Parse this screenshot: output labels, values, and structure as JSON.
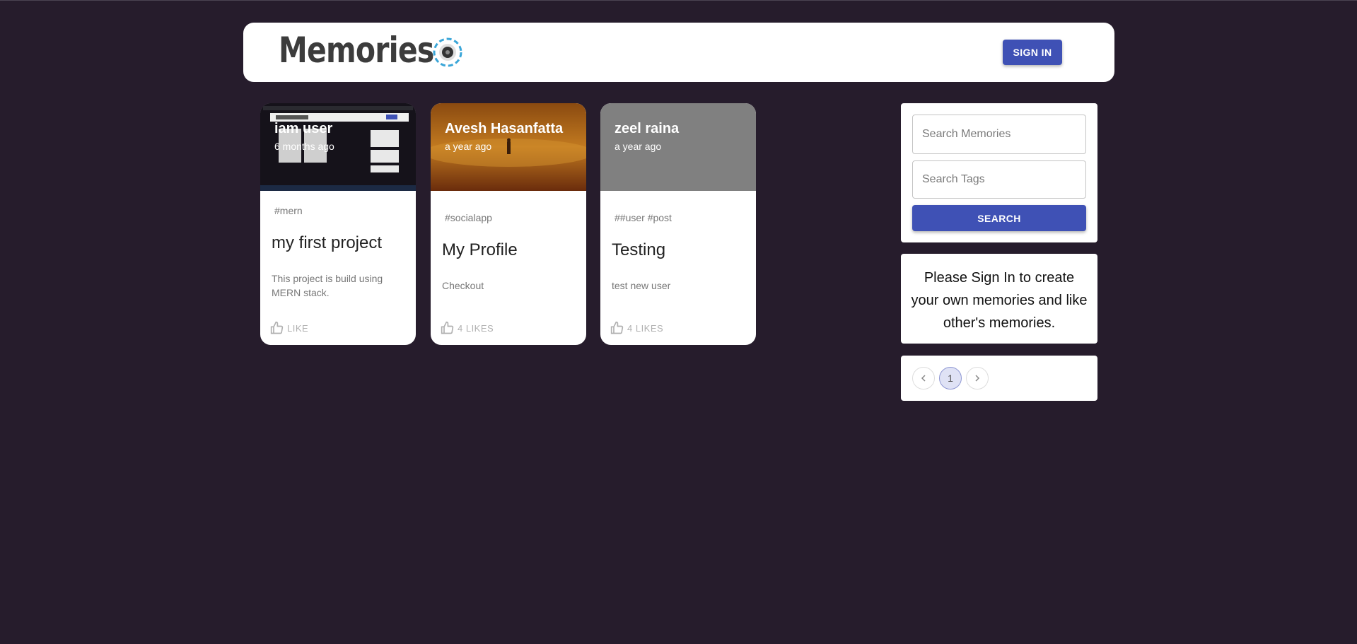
{
  "header": {
    "brand": "Memories",
    "signin_label": "SIGN IN"
  },
  "posts": [
    {
      "author": "iam user",
      "time": "6 months ago",
      "tags": "#mern",
      "title": "my first project",
      "message": "This project is build using MERN stack.",
      "like_label": "LIKE"
    },
    {
      "author": "Avesh Hasanfatta",
      "time": "a year ago",
      "tags": "#socialapp",
      "title": "My Profile",
      "message": "Checkout",
      "like_label": "4 LIKES"
    },
    {
      "author": "zeel raina",
      "time": "a year ago",
      "tags": "##user #post",
      "title": "Testing",
      "message": "test new user",
      "like_label": "4 LIKES"
    }
  ],
  "sidebar": {
    "search_memories_placeholder": "Search Memories",
    "search_tags_placeholder": "Search Tags",
    "search_label": "SEARCH",
    "signin_message": "Please Sign In to create your own memories and like other's memories.",
    "pagination": {
      "current_page": "1"
    }
  },
  "colors": {
    "background": "#261c2c",
    "primary": "#3f51b5",
    "card_placeholder": "#808080"
  }
}
